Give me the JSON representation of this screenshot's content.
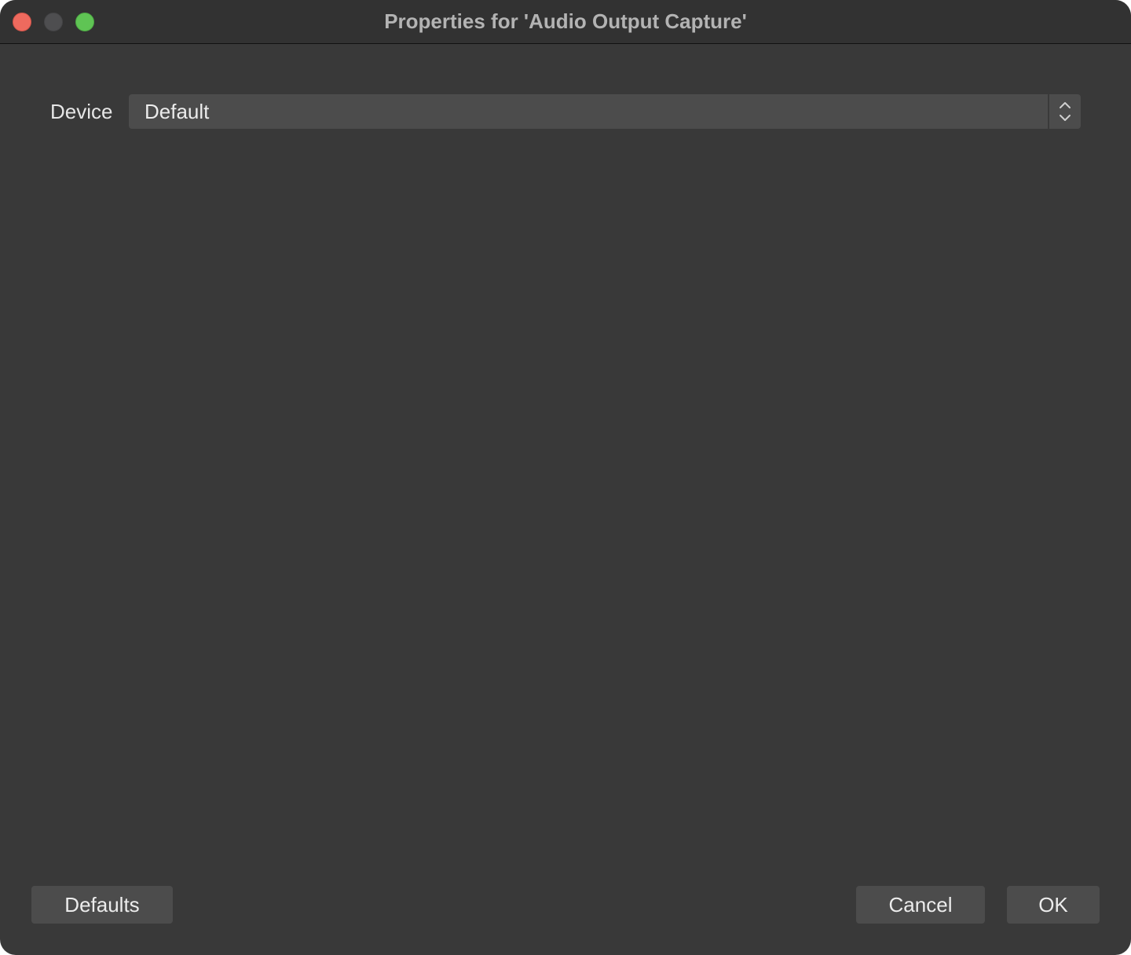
{
  "window": {
    "title": "Properties for 'Audio Output Capture'"
  },
  "form": {
    "device_label": "Device",
    "device_value": "Default"
  },
  "buttons": {
    "defaults_label": "Defaults",
    "cancel_label": "Cancel",
    "ok_label": "OK"
  },
  "icons": {
    "close": "close-icon",
    "minimize": "minimize-icon",
    "zoom": "zoom-icon",
    "select_arrows": "chevron-up-down-icon"
  },
  "colors": {
    "window_bg": "#393939",
    "titlebar_bg": "#323232",
    "control_bg": "#4c4c4c",
    "close": "#ee6a5e",
    "minimize": "#4e4e50",
    "zoom": "#5fc454"
  }
}
